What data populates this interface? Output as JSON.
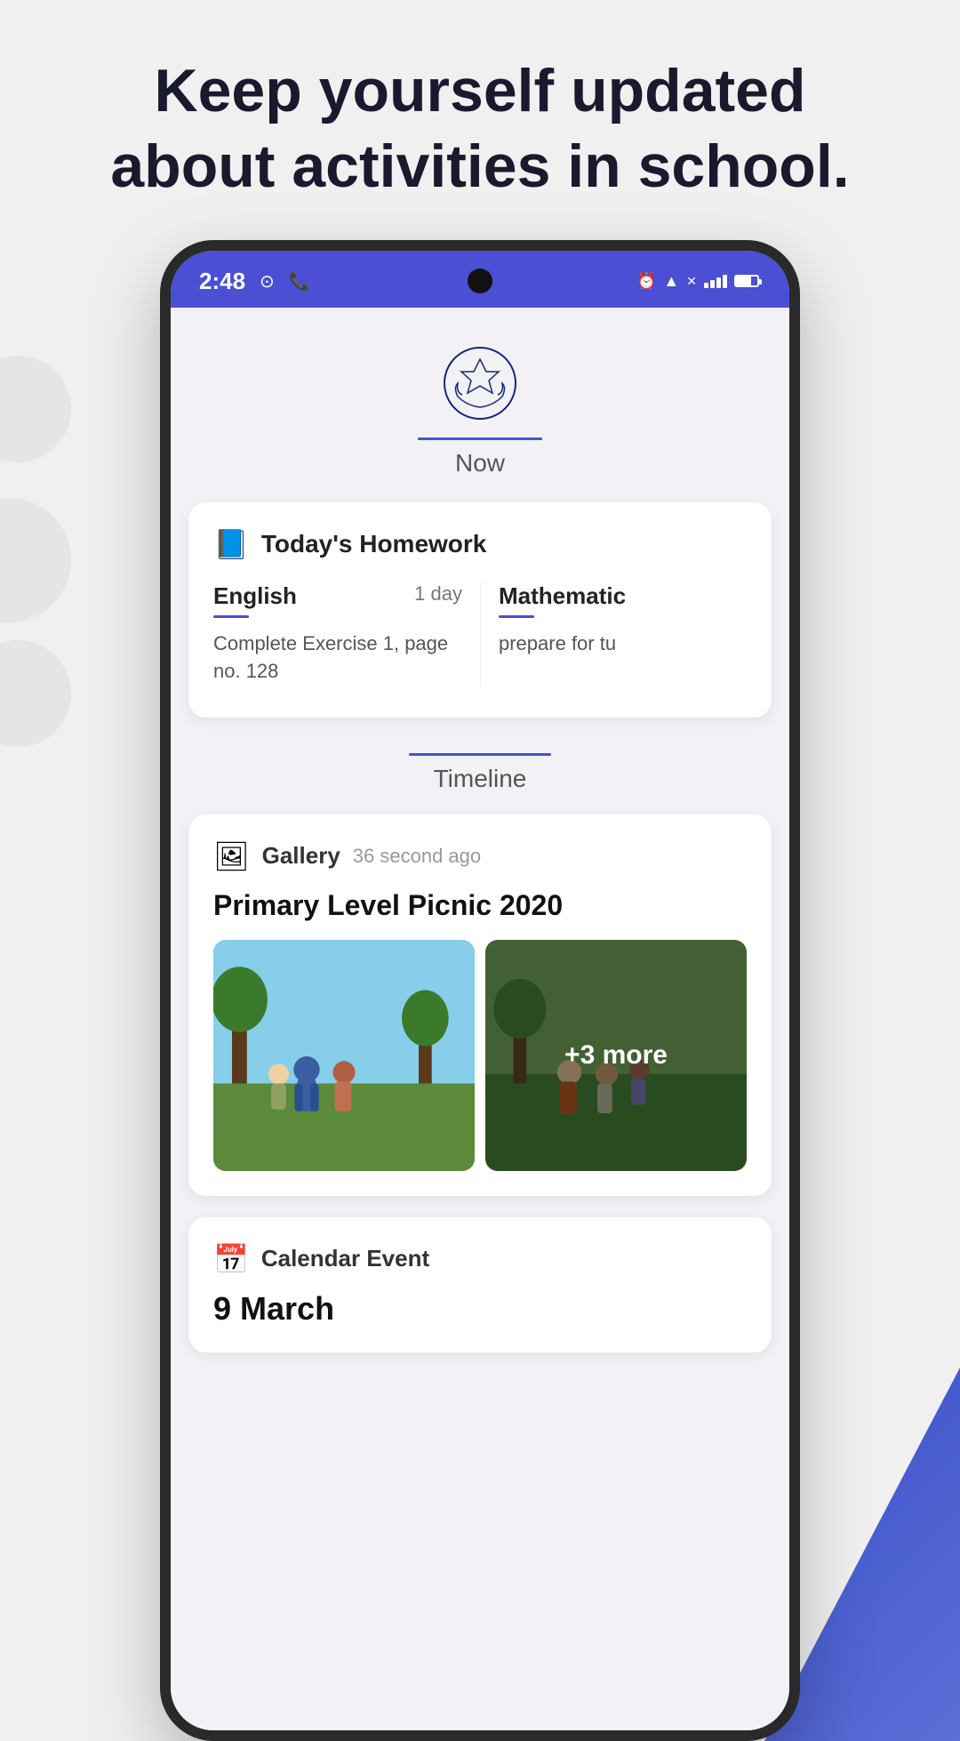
{
  "page": {
    "headline": "Keep yourself updated about activities in school."
  },
  "status_bar": {
    "time": "2:48",
    "icons_left": [
      "notification",
      "whatsapp"
    ],
    "icons_right": [
      "alarm",
      "wifi",
      "signal-x",
      "signal",
      "battery"
    ]
  },
  "school_header": {
    "logo_alt": "School Emblem",
    "tab_label": "Now"
  },
  "homework_section": {
    "title": "Today's Homework",
    "subjects": [
      {
        "name": "English",
        "due": "1 day",
        "description": "Complete Exercise 1, page no. 128"
      },
      {
        "name": "Mathematic",
        "due": "",
        "description": "prepare for tu"
      }
    ]
  },
  "timeline_section": {
    "tab_label": "Timeline",
    "gallery_event": {
      "type": "Gallery",
      "time_ago": "36 second ago",
      "title": "Primary Level Picnic 2020",
      "more_count": "+3 more"
    },
    "calendar_event": {
      "type": "Calendar Event",
      "date": "9 March"
    }
  }
}
